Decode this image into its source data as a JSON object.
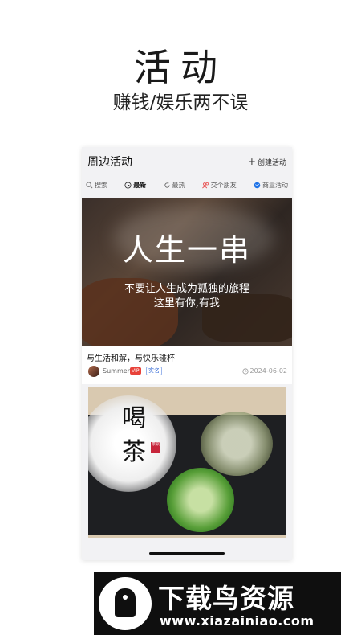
{
  "hero": {
    "title": "活动",
    "subtitle": "赚钱/娱乐两不误"
  },
  "app": {
    "header_title": "周边活动",
    "create_label": "创建活动",
    "tabs": [
      {
        "label": "搜索",
        "icon": "search-icon"
      },
      {
        "label": "最新",
        "icon": "clock-icon",
        "active": true
      },
      {
        "label": "最热",
        "icon": "refresh-icon"
      },
      {
        "label": "交个朋友",
        "icon": "people-icon"
      },
      {
        "label": "商业活动",
        "icon": "globe-icon"
      }
    ],
    "card1": {
      "overlay_title": "人生一串",
      "overlay_line1": "不要让人生成为孤独的旅程",
      "overlay_line2": "这里有你,有我",
      "title": "与生活和解，与快乐碰杯",
      "username": "Summer",
      "vip_badge": "VIP",
      "verified_badge": "实名",
      "date": "2024-06-02"
    },
    "card2": {
      "overlay_char1": "喝",
      "overlay_char2": "茶",
      "seal_text": "茶饮"
    }
  },
  "banner": {
    "brand": "下载鸟资源",
    "url": "www.xiazainiao.com"
  },
  "colors": {
    "vip": "#e8423a",
    "verified": "#2f66d4",
    "accent_blue": "#1e73e8"
  }
}
